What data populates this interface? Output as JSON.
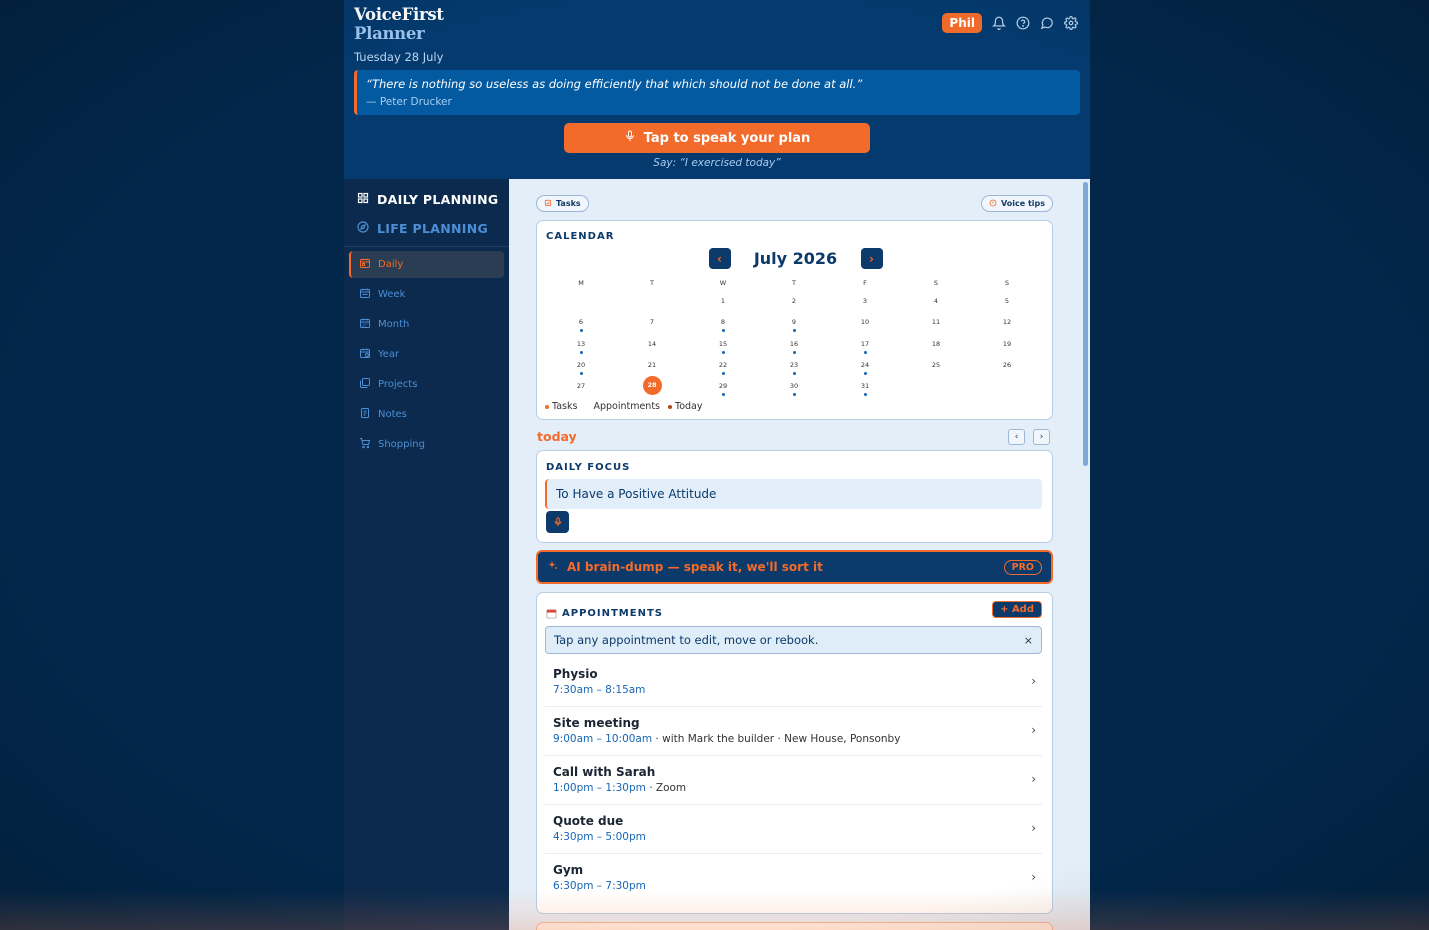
{
  "header": {
    "brand_line1": "VoiceFirst",
    "brand_line2": "Planner",
    "date": "Tuesday 28 July",
    "user": "Phil",
    "icons": [
      "bell-icon",
      "help-icon",
      "chat-icon",
      "gear-icon"
    ],
    "quote": {
      "text": "“There is nothing so useless as doing efficiently that which should not be done at all.”",
      "author": "— Peter Drucker"
    },
    "speak_button": "Tap to speak your plan",
    "speak_hint": "Say: “I exercised today”"
  },
  "sidebar": {
    "sections": [
      "DAILY PLANNING",
      "LIFE PLANNING"
    ],
    "items": [
      {
        "label": "Daily",
        "icon": "calendar-icon",
        "active": true
      },
      {
        "label": "Week",
        "icon": "calendar-week-icon",
        "active": false
      },
      {
        "label": "Month",
        "icon": "calendar-month-icon",
        "active": false
      },
      {
        "label": "Year",
        "icon": "calendar-year-icon",
        "active": false
      },
      {
        "label": "Projects",
        "icon": "folders-icon",
        "active": false
      },
      {
        "label": "Notes",
        "icon": "notes-icon",
        "active": false
      },
      {
        "label": "Shopping",
        "icon": "cart-icon",
        "active": false
      }
    ]
  },
  "main": {
    "tasks_pill": "Tasks",
    "voice_tips_pill": "Voice tips",
    "calendar": {
      "title": "CALENDAR",
      "month": "July 2026",
      "prev": "‹",
      "next": "›",
      "weekdays": [
        "M",
        "T",
        "W",
        "T",
        "F",
        "S",
        "S"
      ],
      "first_weekday_index": 2,
      "days_in_month": 31,
      "today": 28,
      "days_with_dots": [
        6,
        8,
        9,
        13,
        15,
        16,
        17,
        20,
        22,
        23,
        24,
        29,
        30,
        31
      ],
      "legend": {
        "tasks": "Tasks",
        "appointments": "Appointments",
        "today": "Today"
      }
    },
    "today_label": "today",
    "daily_focus": {
      "title": "DAILY FOCUS",
      "value": "To Have a Positive Attitude"
    },
    "brain_dump": {
      "label": "AI brain-dump — speak it, we'll sort it",
      "badge": "PRO"
    },
    "appointments": {
      "title": "APPOINTMENTS",
      "add_label": "+ Add",
      "tip": "Tap any appointment to edit, move or rebook.",
      "dismiss": "×",
      "items": [
        {
          "title": "Physio",
          "time": "7:30am – 8:15am",
          "extra": ""
        },
        {
          "title": "Site meeting",
          "time": "9:00am – 10:00am",
          "extra": " · with Mark the builder · New House, Ponsonby"
        },
        {
          "title": "Call with Sarah",
          "time": "1:00pm – 1:30pm",
          "extra": " · Zoom"
        },
        {
          "title": "Quote due",
          "time": "4:30pm – 5:00pm",
          "extra": ""
        },
        {
          "title": "Gym",
          "time": "6:30pm – 7:30pm",
          "extra": ""
        }
      ]
    }
  },
  "colors": {
    "accent": "#f36b2b",
    "navy": "#0b3a6b",
    "header_bg": "#043a6e",
    "link_blue": "#1766b5"
  }
}
